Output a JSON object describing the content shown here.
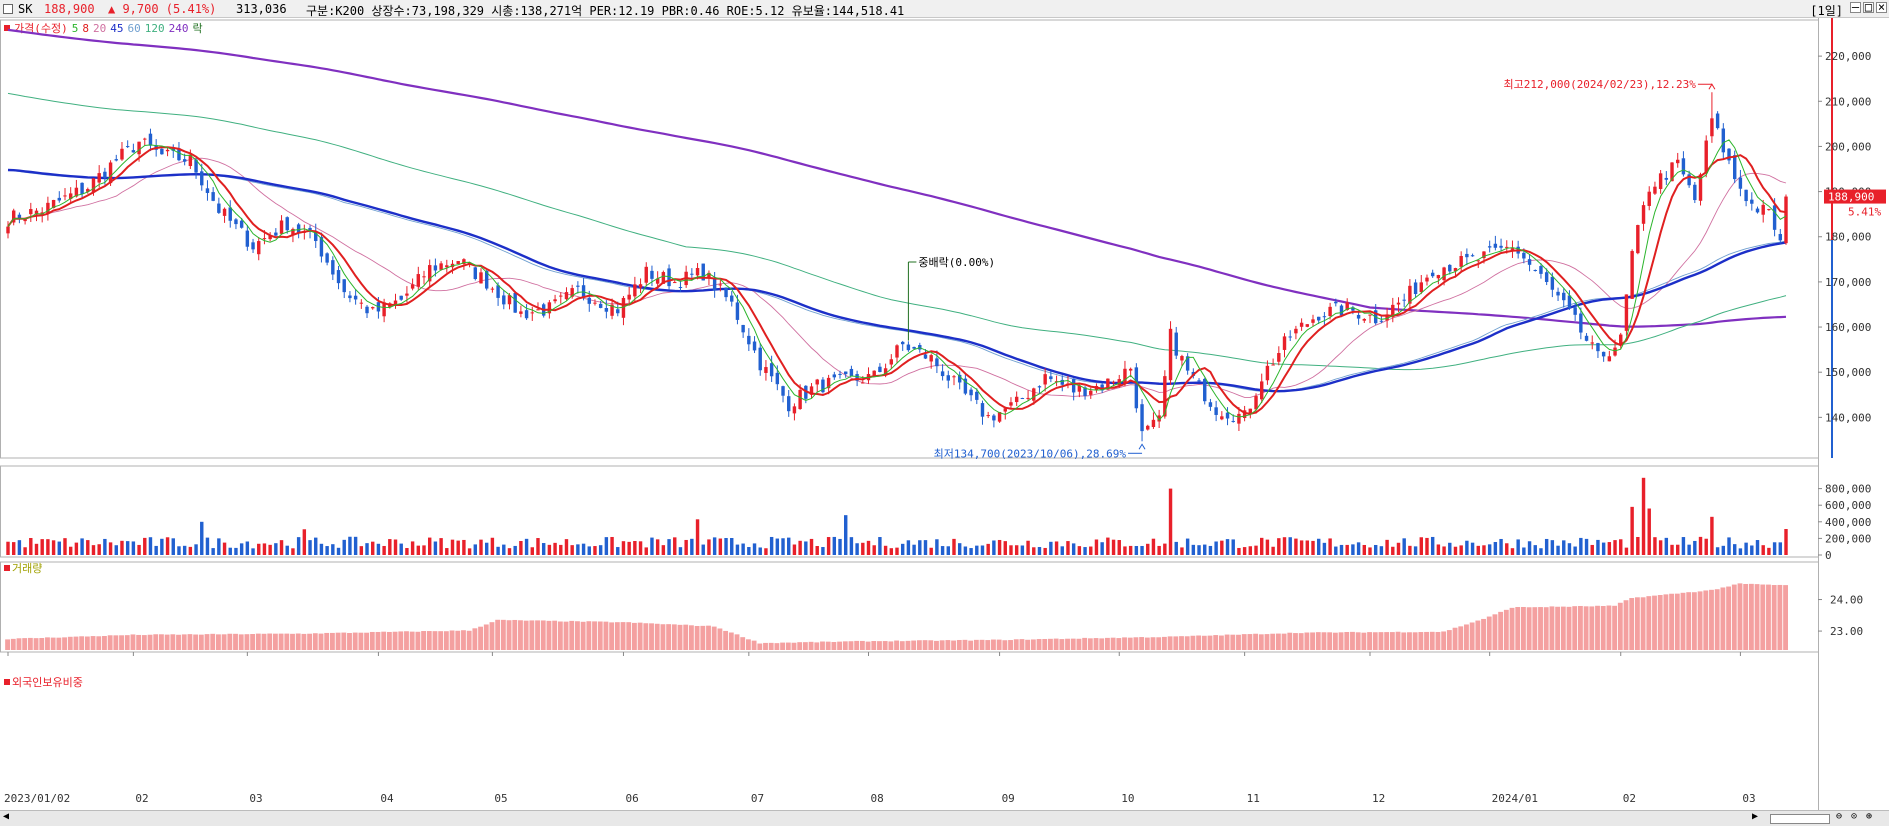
{
  "header": {
    "name": "SK",
    "price": "188,900",
    "change": "▲ 9,700 (5.41%)",
    "volume": "313,036",
    "info": "구분:K200 상장수:73,198,329 시총:138,271억 PER:12.19 PBR:0.46 ROE:5.12 유보율:144,518.41",
    "period": "[1일]"
  },
  "legend": {
    "price_label": "가격(수정)",
    "ma": [
      {
        "label": "5",
        "color": "#2cb52c"
      },
      {
        "label": "8",
        "color": "#e02020"
      },
      {
        "label": "20",
        "color": "#d070a0"
      },
      {
        "label": "45",
        "color": "#1c2fc8"
      },
      {
        "label": "60",
        "color": "#70a0d0"
      },
      {
        "label": "120",
        "color": "#40b080"
      },
      {
        "label": "240",
        "color": "#8030c0"
      }
    ],
    "extra": "락"
  },
  "volume_label": "거래량",
  "foreign_label": "외국인보유비중",
  "colors": {
    "up": "#e8202a",
    "down": "#2160d0",
    "foreign_bar": "#f4a0a0",
    "ma5": "#2cb52c",
    "ma8": "#e02020",
    "ma20": "#d070a0",
    "ma45": "#1c2fc8",
    "ma60": "#70a0d0",
    "ma120": "#40b080",
    "ma240": "#8030c0"
  },
  "annotations": {
    "high": "최고212,000(2024/02/23),12.23%",
    "low": "최저134,700(2023/10/06),28.69%",
    "event": "중배락(0.00%)",
    "price_tag": "188,900",
    "pct_tag": "5.41%"
  },
  "chart_data": [
    {
      "type": "candlestick",
      "title": "SK",
      "ylim": [
        131000,
        228000
      ],
      "yticks": [
        {
          "value": 140000,
          "label": "140,000"
        },
        {
          "value": 150000,
          "label": "150,000"
        },
        {
          "value": 160000,
          "label": "160,000"
        },
        {
          "value": 170000,
          "label": "170,000"
        },
        {
          "value": 180000,
          "label": "180,000"
        },
        {
          "value": 190000,
          "label": "190,000"
        },
        {
          "value": 200000,
          "label": "200,000"
        },
        {
          "value": 210000,
          "label": "210,000"
        },
        {
          "value": 220000,
          "label": "220,000"
        }
      ],
      "xticks": [
        "2023/01/02",
        "02",
        "03",
        "04",
        "05",
        "06",
        "07",
        "08",
        "09",
        "10",
        "11",
        "12",
        "2024/01",
        "02",
        "03"
      ],
      "close_anchors": [
        [
          "2023-01-02",
          184000
        ],
        [
          "2023-01-10",
          186000
        ],
        [
          "2023-01-20",
          191000
        ],
        [
          "2023-01-27",
          197000
        ],
        [
          "2023-02-02",
          201000
        ],
        [
          "2023-02-08",
          198000
        ],
        [
          "2023-02-15",
          197000
        ],
        [
          "2023-02-22",
          186000
        ],
        [
          "2023-03-02",
          178000
        ],
        [
          "2023-03-10",
          183000
        ],
        [
          "2023-03-17",
          179000
        ],
        [
          "2023-03-24",
          168000
        ],
        [
          "2023-03-31",
          163000
        ],
        [
          "2023-04-07",
          166000
        ],
        [
          "2023-04-14",
          173000
        ],
        [
          "2023-04-21",
          175000
        ],
        [
          "2023-04-28",
          170000
        ],
        [
          "2023-05-08",
          163000
        ],
        [
          "2023-05-15",
          164000
        ],
        [
          "2023-05-22",
          168000
        ],
        [
          "2023-05-31",
          164000
        ],
        [
          "2023-06-07",
          172000
        ],
        [
          "2023-06-14",
          170000
        ],
        [
          "2023-06-21",
          172000
        ],
        [
          "2023-06-28",
          165000
        ],
        [
          "2023-07-05",
          152000
        ],
        [
          "2023-07-12",
          143000
        ],
        [
          "2023-07-19",
          147000
        ],
        [
          "2023-07-26",
          148000
        ],
        [
          "2023-08-02",
          149000
        ],
        [
          "2023-08-09",
          156000
        ],
        [
          "2023-08-16",
          153000
        ],
        [
          "2023-08-23",
          146000
        ],
        [
          "2023-08-30",
          140000
        ],
        [
          "2023-09-06",
          143000
        ],
        [
          "2023-09-13",
          149000
        ],
        [
          "2023-09-20",
          146000
        ],
        [
          "2023-09-27",
          147000
        ],
        [
          "2023-10-04",
          151000
        ],
        [
          "2023-10-06",
          136000
        ],
        [
          "2023-10-11",
          139000
        ],
        [
          "2023-10-13",
          158000
        ],
        [
          "2023-10-18",
          150000
        ],
        [
          "2023-10-25",
          142000
        ],
        [
          "2023-11-01",
          140000
        ],
        [
          "2023-11-06",
          149000
        ],
        [
          "2023-11-13",
          158000
        ],
        [
          "2023-11-20",
          163000
        ],
        [
          "2023-11-27",
          164000
        ],
        [
          "2023-12-04",
          162000
        ],
        [
          "2023-12-11",
          166000
        ],
        [
          "2023-12-18",
          173000
        ],
        [
          "2023-12-28",
          175000
        ],
        [
          "2024-01-05",
          178000
        ],
        [
          "2024-01-12",
          171000
        ],
        [
          "2024-01-19",
          163000
        ],
        [
          "2024-01-26",
          153000
        ],
        [
          "2024-02-01",
          157000
        ],
        [
          "2024-02-05",
          176000
        ],
        [
          "2024-02-08",
          191000
        ],
        [
          "2024-02-15",
          196000
        ],
        [
          "2024-02-20",
          188000
        ],
        [
          "2024-02-23",
          206000
        ],
        [
          "2024-02-29",
          193000
        ],
        [
          "2024-03-05",
          187000
        ],
        [
          "2024-03-08",
          185000
        ],
        [
          "2024-03-12",
          179200
        ],
        [
          "2024-03-13",
          188900
        ]
      ],
      "high": {
        "date": "2024-02-23",
        "value": 212000
      },
      "low": {
        "date": "2023-10-06",
        "value": 134700
      },
      "last_close": 188900
    },
    {
      "type": "bar",
      "title": "거래량",
      "ylim": [
        0,
        1000000
      ],
      "yticks": [
        {
          "value": 0,
          "label": "0"
        },
        {
          "value": 200000,
          "label": "200,000"
        },
        {
          "value": 400000,
          "label": "400,000"
        },
        {
          "value": 600000,
          "label": "600,000"
        },
        {
          "value": 800000,
          "label": "800,000"
        }
      ],
      "typical_range": [
        80000,
        220000
      ],
      "spikes": [
        [
          "2023-02-17",
          400000
        ],
        [
          "2023-03-15",
          310000
        ],
        [
          "2023-06-20",
          430000
        ],
        [
          "2023-07-26",
          480000
        ],
        [
          "2023-10-13",
          800000
        ],
        [
          "2024-02-05",
          580000
        ],
        [
          "2024-02-07",
          930000
        ],
        [
          "2024-02-08",
          560000
        ],
        [
          "2024-02-23",
          460000
        ],
        [
          "2024-03-13",
          313036
        ]
      ]
    },
    {
      "type": "bar",
      "title": "외국인보유비중",
      "ylim": [
        22.4,
        25.0
      ],
      "yticks": [
        {
          "value": 23.0,
          "label": "23.00"
        },
        {
          "value": 24.0,
          "label": "24.00"
        }
      ],
      "anchors": [
        [
          "2023-01-02",
          22.75
        ],
        [
          "2023-02-01",
          22.88
        ],
        [
          "2023-03-15",
          22.92
        ],
        [
          "2023-04-25",
          23.02
        ],
        [
          "2023-05-02",
          23.35
        ],
        [
          "2023-06-01",
          23.28
        ],
        [
          "2023-06-25",
          23.15
        ],
        [
          "2023-07-05",
          22.62
        ],
        [
          "2023-08-01",
          22.68
        ],
        [
          "2023-09-01",
          22.72
        ],
        [
          "2023-10-15",
          22.82
        ],
        [
          "2023-11-15",
          22.95
        ],
        [
          "2023-12-20",
          22.98
        ],
        [
          "2024-01-01",
          23.45
        ],
        [
          "2024-01-05",
          23.75
        ],
        [
          "2024-01-31",
          23.8
        ],
        [
          "2024-02-05",
          24.05
        ],
        [
          "2024-02-25",
          24.3
        ],
        [
          "2024-03-01",
          24.5
        ],
        [
          "2024-03-13",
          24.45
        ]
      ]
    }
  ]
}
